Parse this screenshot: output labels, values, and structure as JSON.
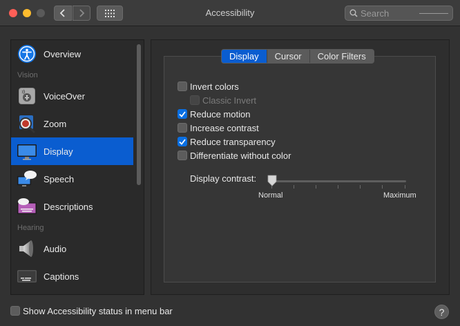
{
  "window": {
    "title": "Accessibility",
    "search_placeholder": "Search"
  },
  "sidebar": {
    "items": [
      {
        "label": "Overview",
        "icon": "accessibility-icon"
      },
      {
        "label": "VoiceOver",
        "icon": "voiceover-icon"
      },
      {
        "label": "Zoom",
        "icon": "zoom-icon"
      },
      {
        "label": "Display",
        "icon": "display-icon",
        "selected": true
      },
      {
        "label": "Speech",
        "icon": "speech-icon"
      },
      {
        "label": "Descriptions",
        "icon": "descriptions-icon"
      },
      {
        "label": "Audio",
        "icon": "speaker-icon"
      },
      {
        "label": "Captions",
        "icon": "captions-icon"
      }
    ],
    "sections": {
      "vision": "Vision",
      "hearing": "Hearing"
    }
  },
  "tabs": [
    {
      "label": "Display",
      "active": true
    },
    {
      "label": "Cursor",
      "active": false
    },
    {
      "label": "Color Filters",
      "active": false
    }
  ],
  "options": [
    {
      "label": "Invert colors",
      "checked": false
    },
    {
      "label": "Classic Invert",
      "checked": false,
      "disabled": true
    },
    {
      "label": "Reduce motion",
      "checked": true
    },
    {
      "label": "Increase contrast",
      "checked": false
    },
    {
      "label": "Reduce transparency",
      "checked": true
    },
    {
      "label": "Differentiate without color",
      "checked": false
    }
  ],
  "contrast": {
    "label": "Display contrast:",
    "min_label": "Normal",
    "max_label": "Maximum",
    "value": 0
  },
  "footer": {
    "status_label": "Show Accessibility status in menu bar",
    "status_checked": false,
    "help_symbol": "?"
  },
  "colors": {
    "accent": "#0a5dd0",
    "checkbox_on": "#0a6fe2"
  }
}
